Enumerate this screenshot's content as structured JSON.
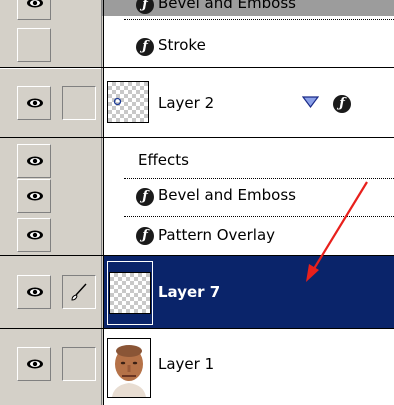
{
  "layers": {
    "partial_top_label": "Bevel and Emboss",
    "stroke_label": "Stroke",
    "layer2_label": "Layer 2",
    "effects_label": "Effects",
    "bevel_label": "Bevel and Emboss",
    "pattern_label": "Pattern Overlay",
    "layer7_label": "Layer 7",
    "layer1_label": "Layer 1"
  },
  "icons": {
    "visibility": "eye-icon",
    "effects": "fx-icon",
    "expand": "triangle-down-icon",
    "brush": "brush-icon",
    "annotation_arrow": "red-arrow"
  },
  "colors": {
    "panel_bg": "#d4d0c8",
    "selection_bg": "#0a246a",
    "selection_text": "#ffffff",
    "arrow": "#e8201c"
  }
}
